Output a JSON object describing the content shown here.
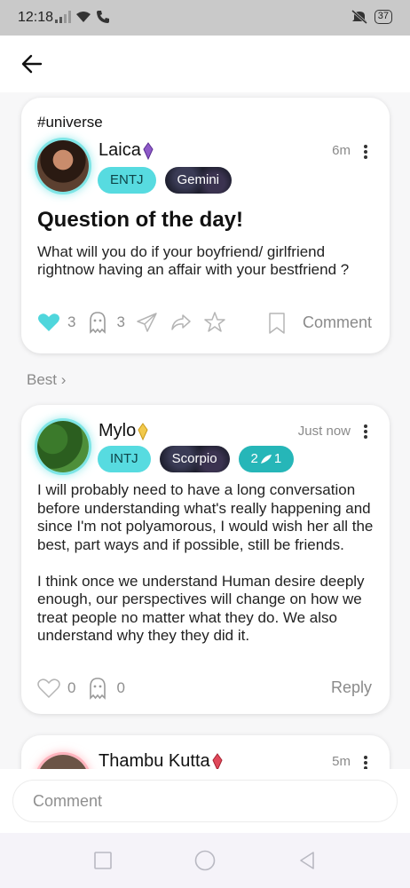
{
  "status_bar": {
    "time": "12:18",
    "battery": "37"
  },
  "post": {
    "hashtag": "#universe",
    "author": "Laica",
    "time": "6m",
    "mbti": "ENTJ",
    "zodiac": "Gemini",
    "title": "Question of the day!",
    "body": "What will you do if  your boyfriend/ girlfriend rightnow having an affair with your bestfriend ?",
    "likes": "3",
    "ghosts": "3",
    "comment_label": "Comment"
  },
  "best_label": "Best ›",
  "comments": [
    {
      "author": "Mylo",
      "time": "Just now",
      "mbti": "INTJ",
      "zodiac": "Scorpio",
      "badge_left": "2",
      "badge_right": "1",
      "body": "I will probably need to have a long conversation before understanding what's really happening and since I'm not polyamorous, I would wish her all the best, part ways and if possible, still be friends.\n\nI think once we understand Human desire deeply enough, our perspectives will change on how we treat people no matter what they do. We also understand why they they did it.",
      "likes": "0",
      "ghosts": "0",
      "reply_label": "Reply"
    },
    {
      "author": "Thambu Kutta",
      "time": "5m"
    }
  ],
  "comment_input": {
    "placeholder": "Comment"
  },
  "colors": {
    "accent": "#57dbe0",
    "dark_tag": "#1e1f2e",
    "teal_badge": "#26b6b8"
  }
}
